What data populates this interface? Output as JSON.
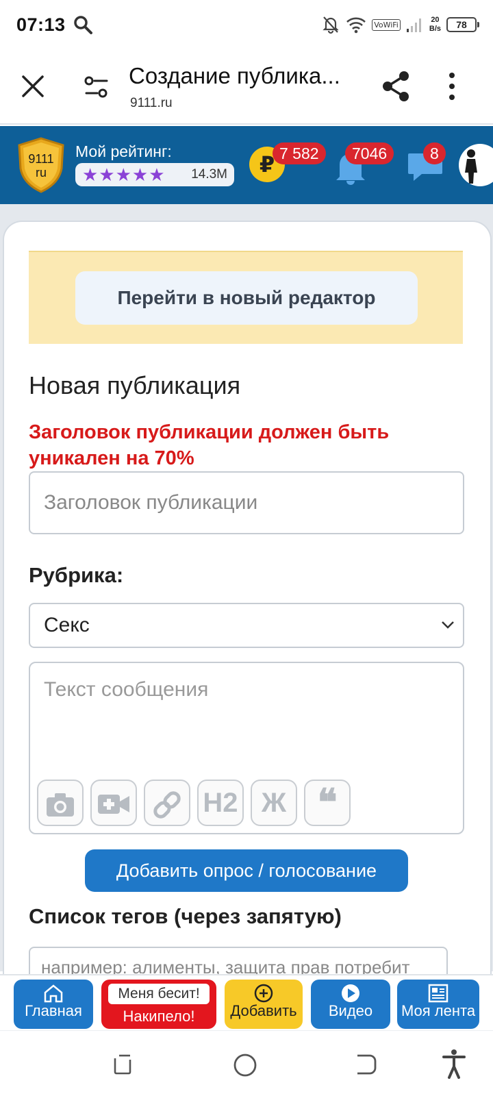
{
  "status_bar": {
    "time": "07:13",
    "vowifi": "VoWiFi",
    "speed_value": "20",
    "speed_unit": "B/s",
    "battery": "78"
  },
  "browser": {
    "title": "Создание публика...",
    "url": "9111.ru"
  },
  "site_header": {
    "logo_line1": "9111",
    "logo_line2": "ru",
    "rating_label": "Мой рейтинг:",
    "rating_stars": "★★★★★",
    "rating_value": "14.3M",
    "coin_symbol": "₽",
    "coins_count": "7 582",
    "notifications_count": "7046",
    "messages_count": "8"
  },
  "form": {
    "new_editor_button": "Перейти в новый редактор",
    "section_title": "Новая публикация",
    "warning": "Заголовок публикации должен быть уникален на 70%",
    "title_placeholder": "Заголовок публикации",
    "rubric_label": "Рубрика:",
    "rubric_value": "Секс",
    "message_placeholder": "Текст сообщения",
    "toolbar": {
      "h2_label": "H2",
      "bold_label": "Ж",
      "quote_label": "❝"
    },
    "poll_button": "Добавить опрос / голосование",
    "tags_label": "Список тегов (через запятую)",
    "tags_placeholder": "например: алименты, защита прав потребит"
  },
  "bottom_nav": {
    "home": "Главная",
    "annoyed_top": "Меня бесит!",
    "annoyed_bottom": "Накипело!",
    "add": "Добавить",
    "video": "Видео",
    "feed": "Моя лента"
  },
  "colors": {
    "brand_blue": "#0e5f98",
    "button_blue": "#1f78c8",
    "warning_red": "#d71a1a",
    "badge_red": "#d9262e",
    "add_yellow": "#f7c928",
    "banner_yellow": "#fbe9b3"
  }
}
